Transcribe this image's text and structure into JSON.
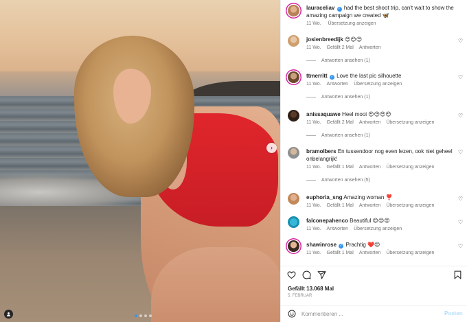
{
  "post": {
    "author": "lauraceliav",
    "caption": "had the best shoot trip, can't wait to show the amazing campaign we created",
    "caption_emoji": "🦋",
    "age": "11 Wo.",
    "translate": "Übersetzung anzeigen",
    "likes": "Gefällt 13.068 Mal",
    "date": "5. Februar",
    "carousel": {
      "slides": 4,
      "active": 1
    }
  },
  "comments": [
    {
      "user": "josienbreedijk",
      "verified": false,
      "text": "",
      "emoji": [
        "😍",
        "😍",
        "😍"
      ],
      "age": "11 Wo.",
      "likes": "Gefällt 2 Mal",
      "reply": "Antworten",
      "translate": "",
      "replies": "Antworten ansehen (1)"
    },
    {
      "user": "ttmerritt",
      "verified": true,
      "text": "Love the last pic silhouette",
      "emoji": [],
      "age": "11 Wo.",
      "likes": "",
      "reply": "Antworten",
      "translate": "Übersetzung anzeigen",
      "replies": "Antworten ansehen (1)"
    },
    {
      "user": "anissaquawe",
      "verified": false,
      "text": "Heel mooi",
      "emoji": [
        "😍",
        "😍",
        "😍",
        "😍"
      ],
      "age": "11 Wo.",
      "likes": "Gefällt 2 Mal",
      "reply": "Antworten",
      "translate": "Übersetzung anzeigen",
      "replies": "Antworten ansehen (1)"
    },
    {
      "user": "bramolbers",
      "verified": false,
      "text": "En tussendoor nog even lezen, ook niet geheel onbelangrijk!",
      "emoji": [],
      "age": "11 Wo.",
      "likes": "Gefällt 1 Mal",
      "reply": "Antworten",
      "translate": "Übersetzung anzeigen",
      "replies": "Antworten ansehen (5)"
    },
    {
      "user": "euphoria_sng",
      "verified": false,
      "text": "Amazing woman",
      "emoji": [
        "❣️"
      ],
      "age": "11 Wo.",
      "likes": "Gefällt 1 Mal",
      "reply": "Antworten",
      "translate": "Übersetzung anzeigen",
      "replies": ""
    },
    {
      "user": "falconepahenco",
      "verified": false,
      "text": "Beautiful",
      "emoji": [
        "😍",
        "😍",
        "😍"
      ],
      "age": "11 Wo.",
      "likes": "",
      "reply": "Antworten",
      "translate": "Übersetzung anzeigen",
      "replies": ""
    },
    {
      "user": "shawinrose",
      "verified": true,
      "text": "Prachtig",
      "emoji": [
        "❤️",
        "😍"
      ],
      "age": "11 Wo.",
      "likes": "Gefällt 1 Mal",
      "reply": "Antworten",
      "translate": "Übersetzung anzeigen",
      "replies": ""
    }
  ],
  "composer": {
    "placeholder": "Kommentieren ...",
    "post_label": "Posten"
  },
  "icons": {
    "like": "heart-icon",
    "comment": "comment-icon",
    "share": "paper-plane-icon",
    "save": "bookmark-icon",
    "emoji": "smiley-icon",
    "next": "chevron-right-icon",
    "tag": "person-tag-icon"
  },
  "colors": {
    "accent": "#3797f0",
    "ring": "#d6249f",
    "muted": "#737373",
    "suit": "#d6232a"
  }
}
